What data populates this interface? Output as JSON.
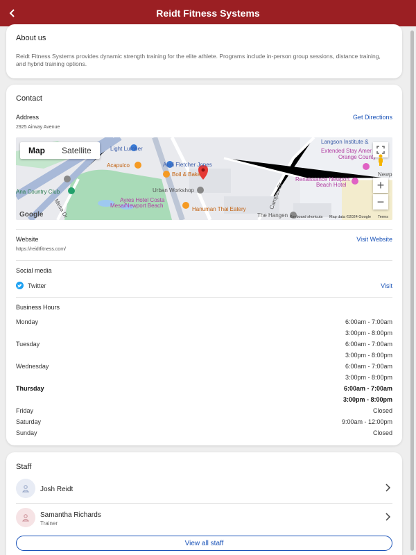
{
  "header": {
    "title": "Reidt Fitness Systems"
  },
  "about": {
    "title": "About us",
    "text": "Reidt Fitness Systems provides dynamic strength training for the elite athlete. Programs include in-person group sessions, distance training, and hybrid training options."
  },
  "contact": {
    "title": "Contact",
    "address_label": "Address",
    "address": "2925 Airway Avenue",
    "directions": "Get Directions",
    "map": {
      "tab_map": "Map",
      "tab_satellite": "Satellite",
      "places": [
        "Langson Institute &",
        "Extended Stay Amer",
        "Orange County",
        "Acapulco",
        "Audi Fletcher Jones",
        "Boil & Bake",
        "Urban Workshop",
        "Ayres Hotel Costa",
        "Mesa/Newport Beach",
        "Hanuman Thai Eatery",
        "Renaissance Newport",
        "Beach Hotel",
        "Newpo",
        "The Hangen",
        "Ana Country Club",
        "Campus Dr",
        "Mesa Dr",
        "Light Lumber"
      ],
      "google": "Google",
      "shortcuts": "Keyboard shortcuts",
      "mapdata": "Map data ©2024 Google",
      "terms": "Terms"
    },
    "website_label": "Website",
    "website": "https://reidtfitness.com/",
    "visit_website": "Visit Website",
    "social_label": "Social media",
    "twitter": "Twitter",
    "visit": "Visit",
    "hours_label": "Business Hours",
    "hours": [
      {
        "day": "Monday",
        "t1": "6:00am - 7:00am",
        "t2": "3:00pm - 8:00pm"
      },
      {
        "day": "Tuesday",
        "t1": "6:00am - 7:00am",
        "t2": "3:00pm - 8:00pm"
      },
      {
        "day": "Wednesday",
        "t1": "6:00am - 7:00am",
        "t2": "3:00pm - 8:00pm"
      },
      {
        "day": "Thursday",
        "t1": "6:00am - 7:00am",
        "t2": "3:00pm - 8:00pm"
      },
      {
        "day": "Friday",
        "t1": "Closed"
      },
      {
        "day": "Saturday",
        "t1": "9:00am - 12:00pm"
      },
      {
        "day": "Sunday",
        "t1": "Closed"
      }
    ]
  },
  "staff": {
    "title": "Staff",
    "members": [
      {
        "name": "Josh Reidt",
        "role": ""
      },
      {
        "name": "Samantha Richards",
        "role": "Trainer"
      }
    ],
    "view_all": "View all staff"
  },
  "colors": {
    "header": "#9b1f23",
    "link": "#1a53b8"
  }
}
